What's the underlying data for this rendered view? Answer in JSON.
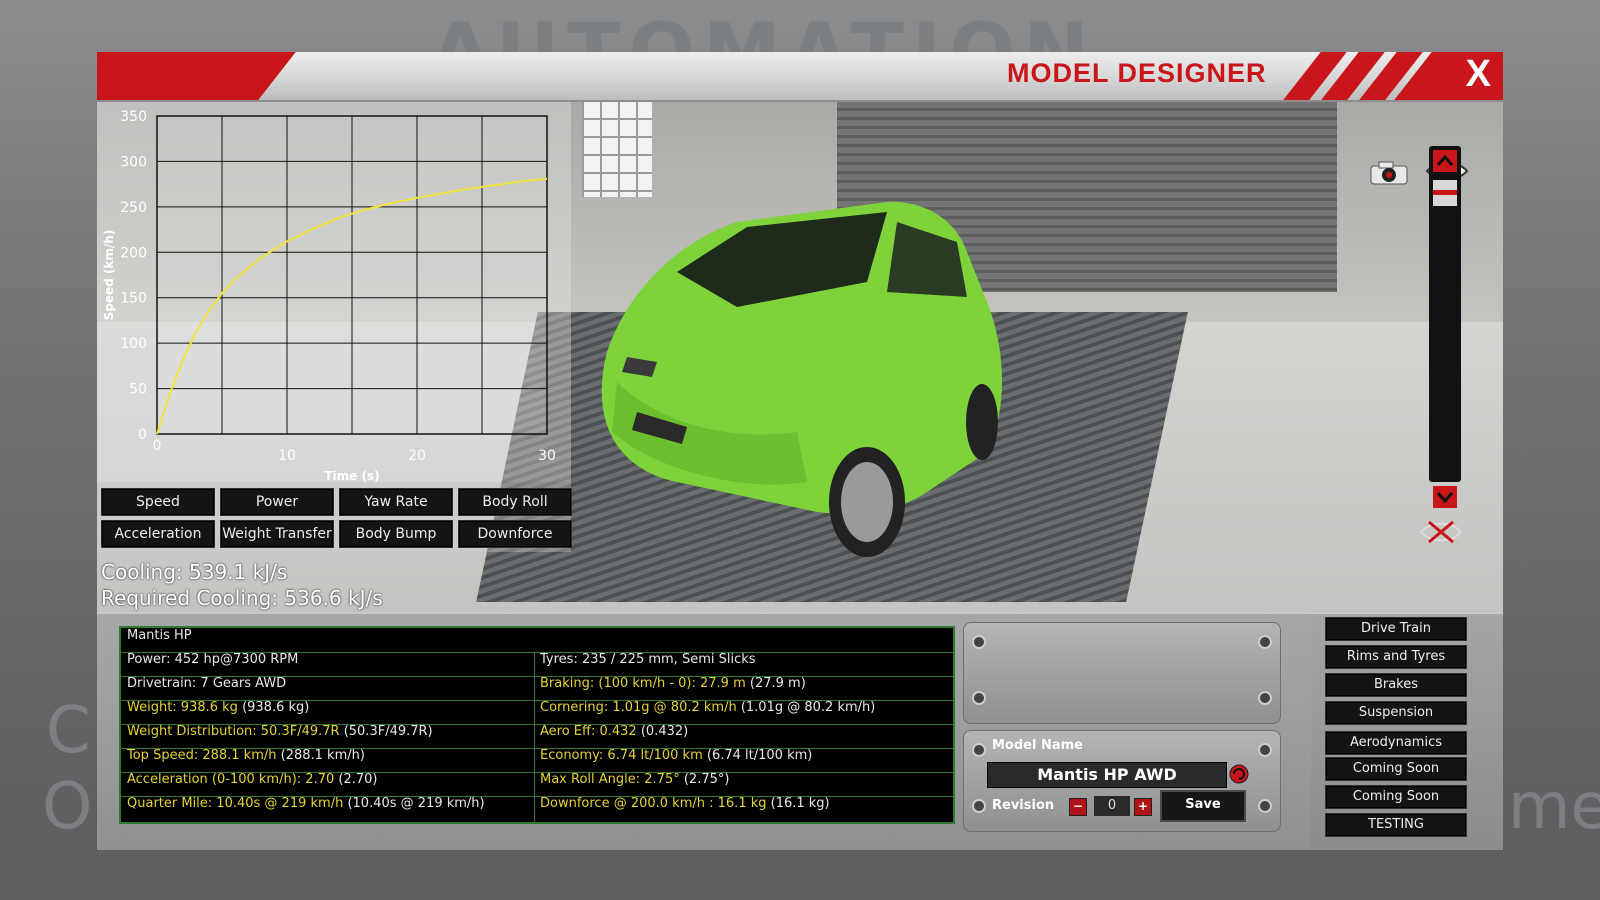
{
  "window": {
    "title": "MODEL DESIGNER",
    "close_label": "X"
  },
  "background": {
    "logo_text": "AUTOMATION",
    "left_text_1": "C",
    "left_text_2": "O",
    "right_text": "me"
  },
  "graph": {
    "chart_data": {
      "type": "line",
      "xlabel": "Time (s)",
      "ylabel": "Speed (km/h)",
      "xlim": [
        0,
        30
      ],
      "ylim": [
        0,
        350
      ],
      "x_ticks": [
        0,
        10,
        20,
        30
      ],
      "y_ticks": [
        0,
        50,
        100,
        150,
        200,
        250,
        300,
        350
      ],
      "grid": true,
      "series": [
        {
          "color": "#f2e33c",
          "x": [
            0,
            1,
            2,
            3,
            4,
            5,
            6,
            8,
            10,
            12,
            14,
            16,
            18,
            20,
            22,
            24,
            26,
            28,
            30
          ],
          "values": [
            0,
            45,
            82,
            112,
            136,
            155,
            170,
            194,
            212,
            226,
            238,
            247,
            254,
            260,
            265,
            270,
            274,
            278,
            281
          ]
        }
      ]
    }
  },
  "graph_buttons": [
    "Speed",
    "Power",
    "Yaw Rate",
    "Body Roll",
    "Acceleration",
    "Weight Transfer",
    "Body Bump",
    "Downforce"
  ],
  "cooling": {
    "cooling": "Cooling: 539.1 kJ/s",
    "required": "Required Cooling: 536.6 kJ/s"
  },
  "stats": {
    "model_header": "Mantis HP",
    "rows": [
      {
        "left": "Power: 452 hp@7300 RPM",
        "left_extra": "",
        "left_hl": false,
        "right": "Tyres: 235 / 225 mm, Semi Slicks",
        "right_extra": "",
        "right_hl": false
      },
      {
        "left": "Drivetrain: 7 Gears AWD",
        "left_extra": "",
        "left_hl": false,
        "right": "Braking: (100 km/h - 0): 27.9 m",
        "right_extra": " (27.9 m)",
        "right_hl": true
      },
      {
        "left": "Weight: 938.6 kg",
        "left_extra": " (938.6 kg)",
        "left_hl": true,
        "right": "Cornering: 1.01g @ 80.2 km/h",
        "right_extra": " (1.01g @ 80.2 km/h)",
        "right_hl": true
      },
      {
        "left": "Weight Distribution: 50.3F/49.7R",
        "left_extra": " (50.3F/49.7R)",
        "left_hl": true,
        "right": "Aero Eff: 0.432",
        "right_extra": " (0.432)",
        "right_hl": true
      },
      {
        "left": "Top Speed: 288.1 km/h",
        "left_extra": " (288.1 km/h)",
        "left_hl": true,
        "right": "Economy: 6.74 lt/100 km",
        "right_extra": " (6.74 lt/100 km)",
        "right_hl": true
      },
      {
        "left": "Acceleration (0-100 km/h): 2.70",
        "left_extra": " (2.70)",
        "left_hl": true,
        "right": "Max Roll Angle: 2.75°",
        "right_extra": " (2.75°)",
        "right_hl": true
      },
      {
        "left": "Quarter Mile: 10.40s @ 219 km/h",
        "left_extra": " (10.40s @ 219 km/h)",
        "left_hl": true,
        "right": "Downforce @ 200.0 km/h : 16.1 kg",
        "right_extra": " (16.1 kg)",
        "right_hl": true
      }
    ]
  },
  "model_panel": {
    "model_name_label": "Model Name",
    "model_name_value": "Mantis HP AWD",
    "revision_label": "Revision",
    "revision_value": "0",
    "minus_label": "−",
    "plus_label": "+",
    "save_label": "Save"
  },
  "nav": [
    "Drive Train",
    "Rims and Tyres",
    "Brakes",
    "Suspension",
    "Aerodynamics",
    "Coming Soon",
    "Coming Soon",
    "TESTING"
  ],
  "colors": {
    "accent_red": "#c8161b",
    "stat_highlight": "#e5d23a",
    "stat_border": "#2f7a2f",
    "car_green": "#7ed23a"
  }
}
